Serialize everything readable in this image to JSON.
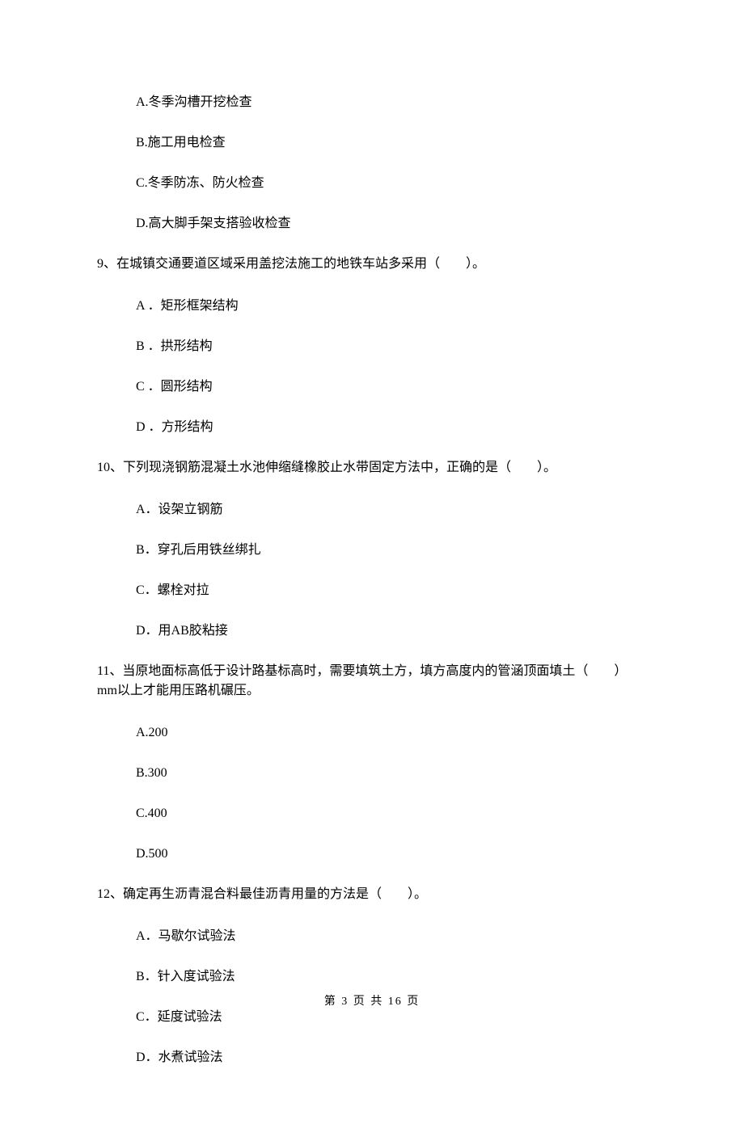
{
  "options_block1": {
    "a": "A.冬季沟槽开挖检查",
    "b": "B.施工用电检查",
    "c": "C.冬季防冻、防火检查",
    "d": "D.高大脚手架支搭验收检查"
  },
  "q9": {
    "stem": "9、在城镇交通要道区域采用盖挖法施工的地铁车站多采用（　　）。",
    "a": "A ．矩形框架结构",
    "b": "B ．拱形结构",
    "c": "C ．圆形结构",
    "d": "D ．方形结构"
  },
  "q10": {
    "stem": "10、下列现浇钢筋混凝土水池伸缩缝橡胶止水带固定方法中，正确的是（　　）。",
    "a": "A．设架立钢筋",
    "b": "B．穿孔后用铁丝绑扎",
    "c": "C．螺栓对拉",
    "d": "D．用AB胶粘接"
  },
  "q11": {
    "stem": "11、当原地面标高低于设计路基标高时，需要填筑土方，填方高度内的管涵顶面填土（　　）mm以上才能用压路机碾压。",
    "a": "A.200",
    "b": "B.300",
    "c": "C.400",
    "d": "D.500"
  },
  "q12": {
    "stem": "12、确定再生沥青混合料最佳沥青用量的方法是（　　）。",
    "a": "A．马歇尔试验法",
    "b": "B．针入度试验法",
    "c": "C．延度试验法",
    "d": "D．水煮试验法"
  },
  "footer": "第 3 页 共 16 页"
}
